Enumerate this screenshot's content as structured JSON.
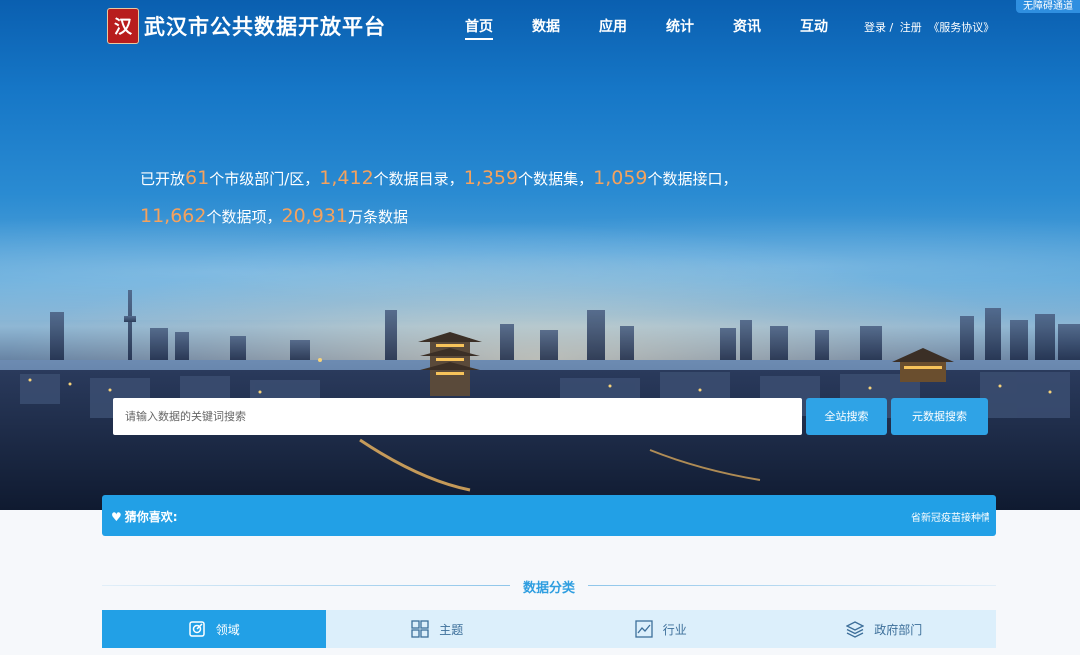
{
  "accessibility": {
    "label": "无障碍通道"
  },
  "header": {
    "logo_seal_text": "汉",
    "title": "武汉市公共数据开放平台",
    "nav": [
      {
        "label": "首页",
        "active": true
      },
      {
        "label": "数据",
        "active": false
      },
      {
        "label": "应用",
        "active": false
      },
      {
        "label": "统计",
        "active": false
      },
      {
        "label": "资讯",
        "active": false
      },
      {
        "label": "互动",
        "active": false
      }
    ],
    "auth": {
      "login": "登录 /",
      "register": "注册",
      "agreement": "《服务协议》"
    }
  },
  "stats": {
    "prefix": "已开放",
    "departments": "61",
    "departments_label": "个市级部门/区，",
    "catalogs": "1,412",
    "catalogs_label": "个数据目录，",
    "datasets": "1,359",
    "datasets_label": "个数据集，",
    "apis": "1,059",
    "apis_label": "个数据接口，",
    "items": "11,662",
    "items_label": "个数据项，",
    "records": "20,931",
    "records_label": "万条数据"
  },
  "search": {
    "placeholder": "请输入数据的关键词搜索",
    "site_search_label": "全站搜索",
    "meta_search_label": "元数据搜索"
  },
  "guess": {
    "label": "猜你喜欢:",
    "item": "省新冠疫苗接种情况"
  },
  "section": {
    "title": "数据分类"
  },
  "tabs": [
    {
      "label": "领域",
      "icon": "target-icon",
      "active": true
    },
    {
      "label": "主题",
      "icon": "grid-icon",
      "active": false
    },
    {
      "label": "行业",
      "icon": "chart-icon",
      "active": false
    },
    {
      "label": "政府部门",
      "icon": "layers-icon",
      "active": false
    }
  ],
  "colors": {
    "accent": "#22a0e6",
    "number": "#f5a25d",
    "seal": "#b81d1d"
  }
}
